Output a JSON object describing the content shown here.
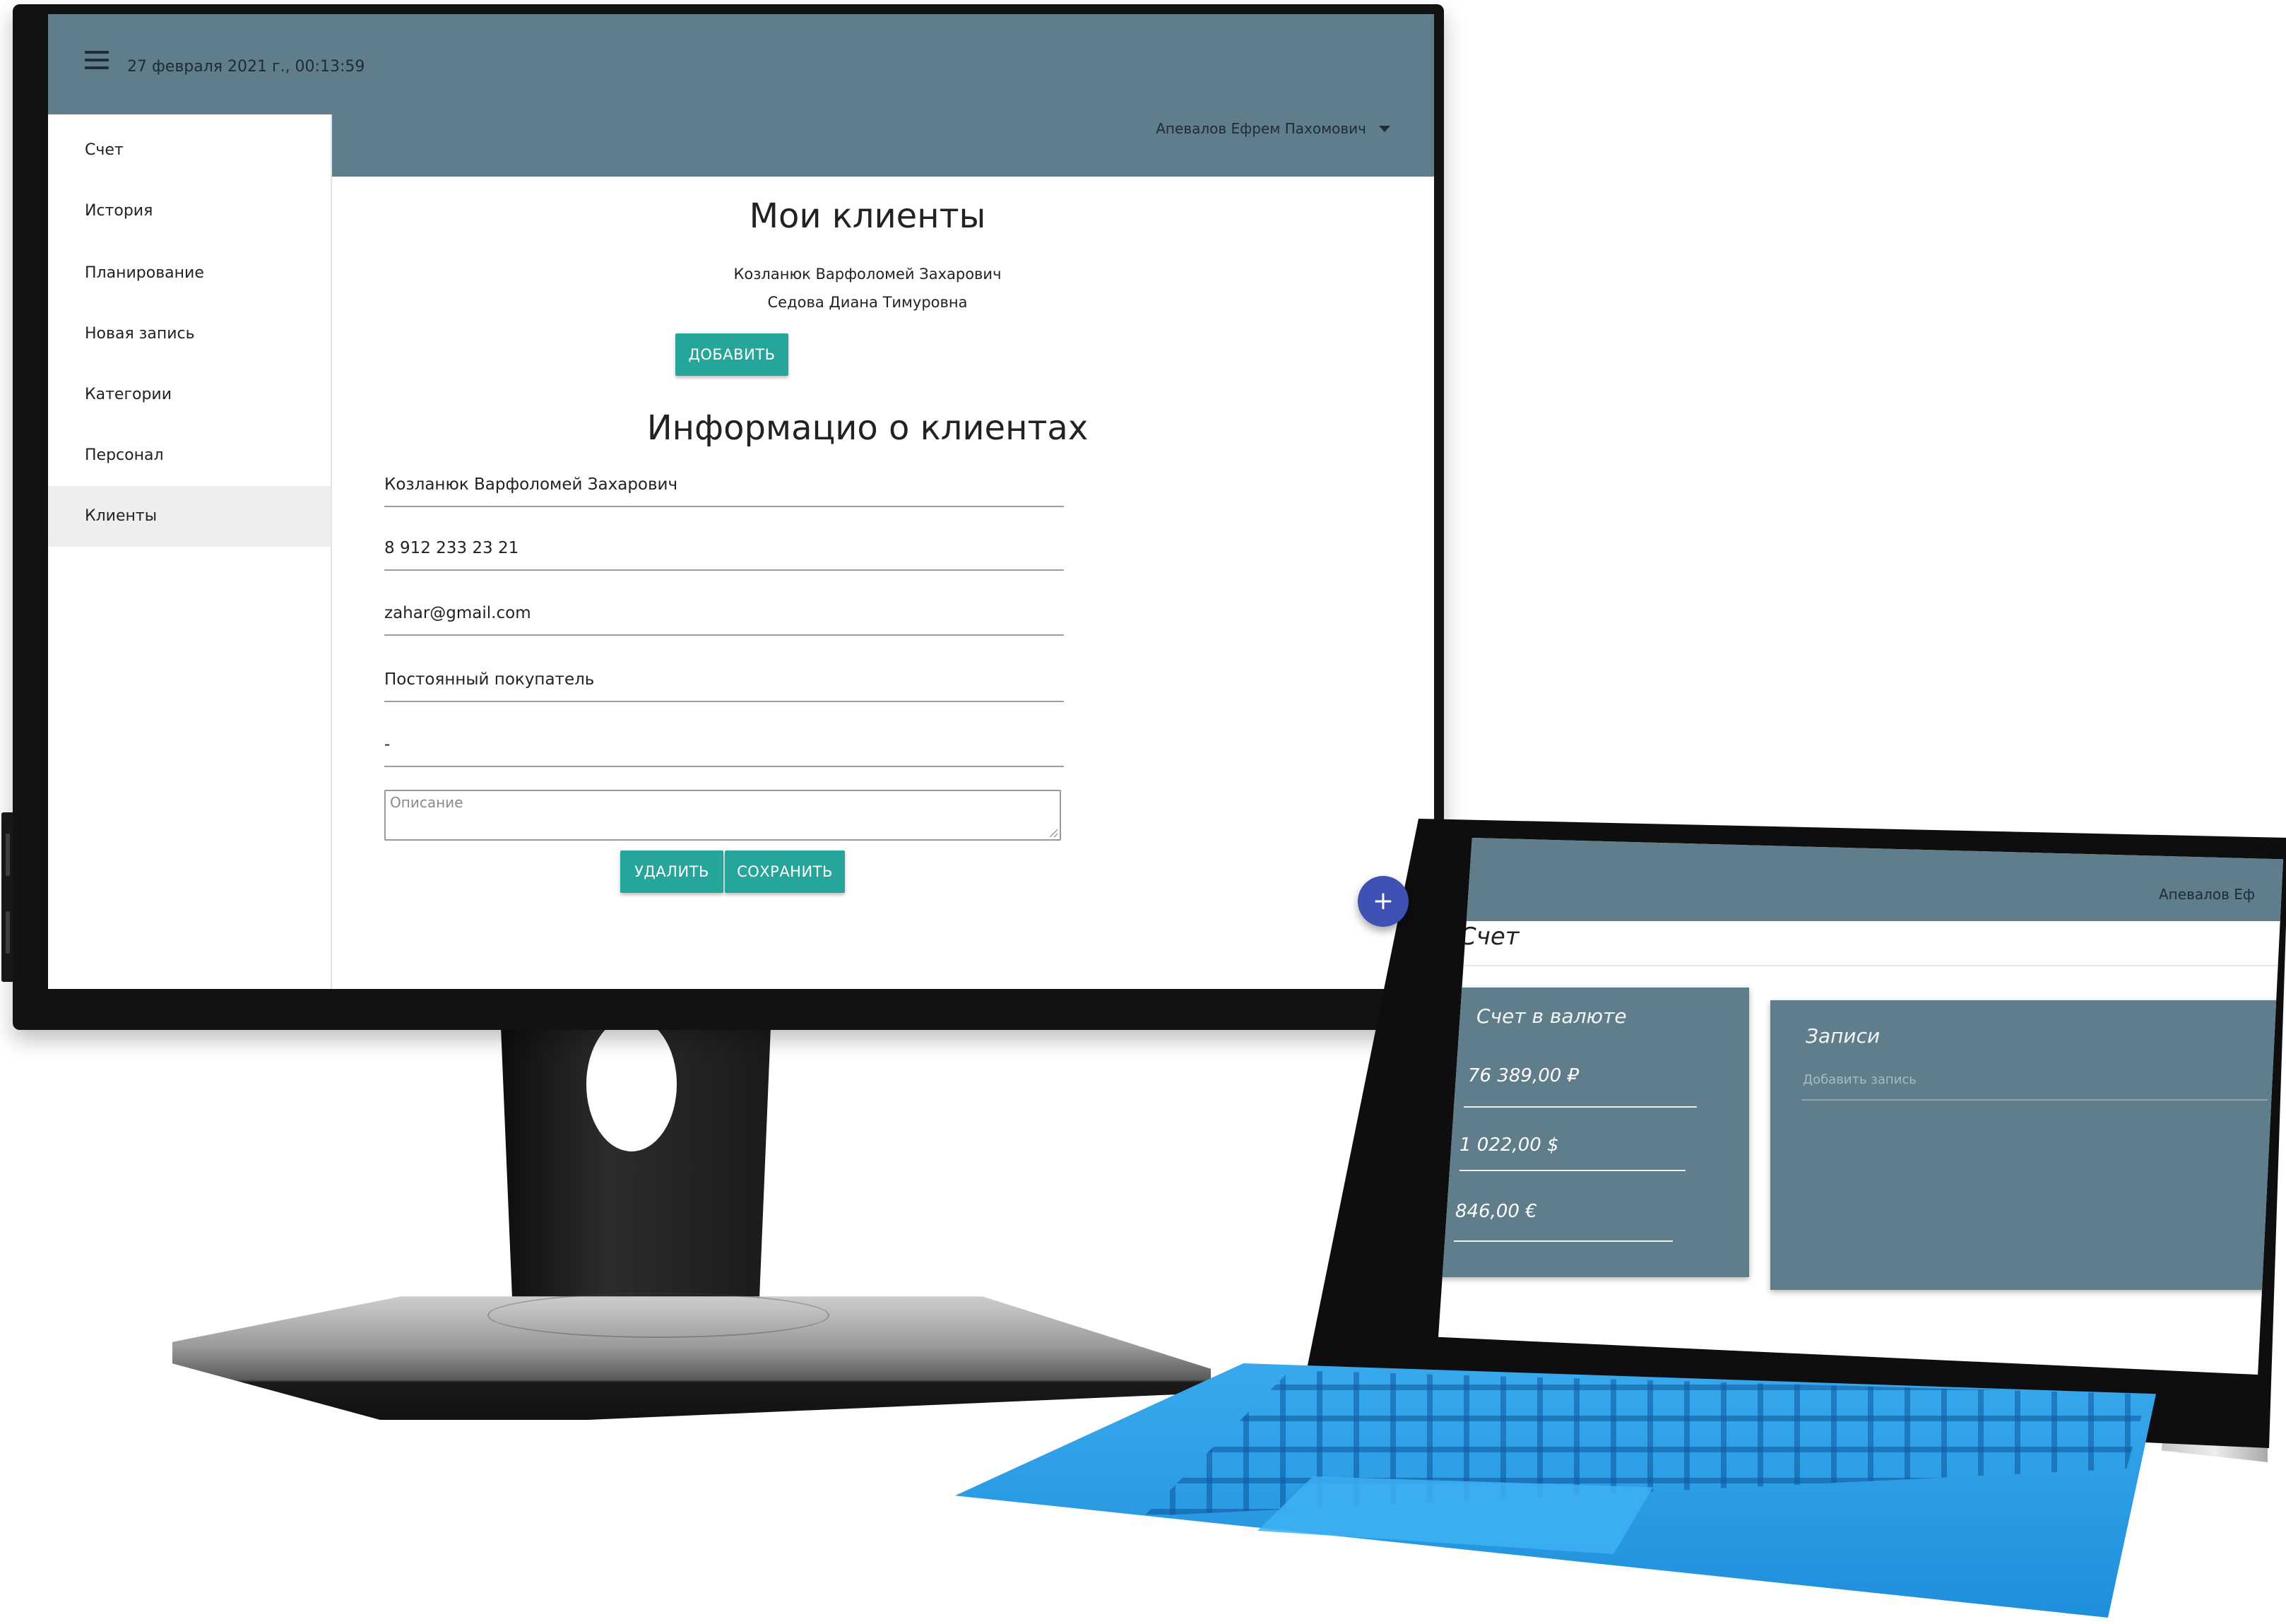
{
  "monitor": {
    "date": "27 февраля 2021 г., 00:13:59",
    "user": "Апевалов Ефрем Пахомович",
    "sidebar": {
      "items": [
        {
          "label": "Счет"
        },
        {
          "label": "История"
        },
        {
          "label": "Планирование"
        },
        {
          "label": "Новая запись"
        },
        {
          "label": "Категории"
        },
        {
          "label": "Персонал"
        },
        {
          "label": "Клиенты",
          "active": true
        }
      ]
    },
    "clients": {
      "title": "Мои клиенты",
      "list": [
        "Козланюк Варфоломей Захарович",
        "Седова Диана Тимуровна"
      ],
      "add_label": "ДОБАВИТЬ"
    },
    "info": {
      "title": "Информацио о клиентах",
      "name": "Козланюк Варфоломей Захарович",
      "phone": "8 912 233 23 21",
      "email": "zahar@gmail.com",
      "status": "Постоянный покупатель",
      "extra": "-",
      "description_placeholder": "Описание",
      "delete_label": "УДАЛИТЬ",
      "save_label": "СОХРАНИТЬ"
    },
    "fab_label": "+"
  },
  "tablet": {
    "user": "Апевалов Еф",
    "title": "Счет",
    "currency_card": {
      "title": "Счет в валюте",
      "values": [
        "76 389,00 ₽",
        "1 022,00 $",
        "846,00 €"
      ]
    },
    "records_card": {
      "title": "Записи",
      "placeholder": "Добавить запись"
    }
  },
  "colors": {
    "header": "#607d8b",
    "accent": "#26a69a",
    "fab": "#3f51b5",
    "keyboard": "#1f8fdc"
  }
}
